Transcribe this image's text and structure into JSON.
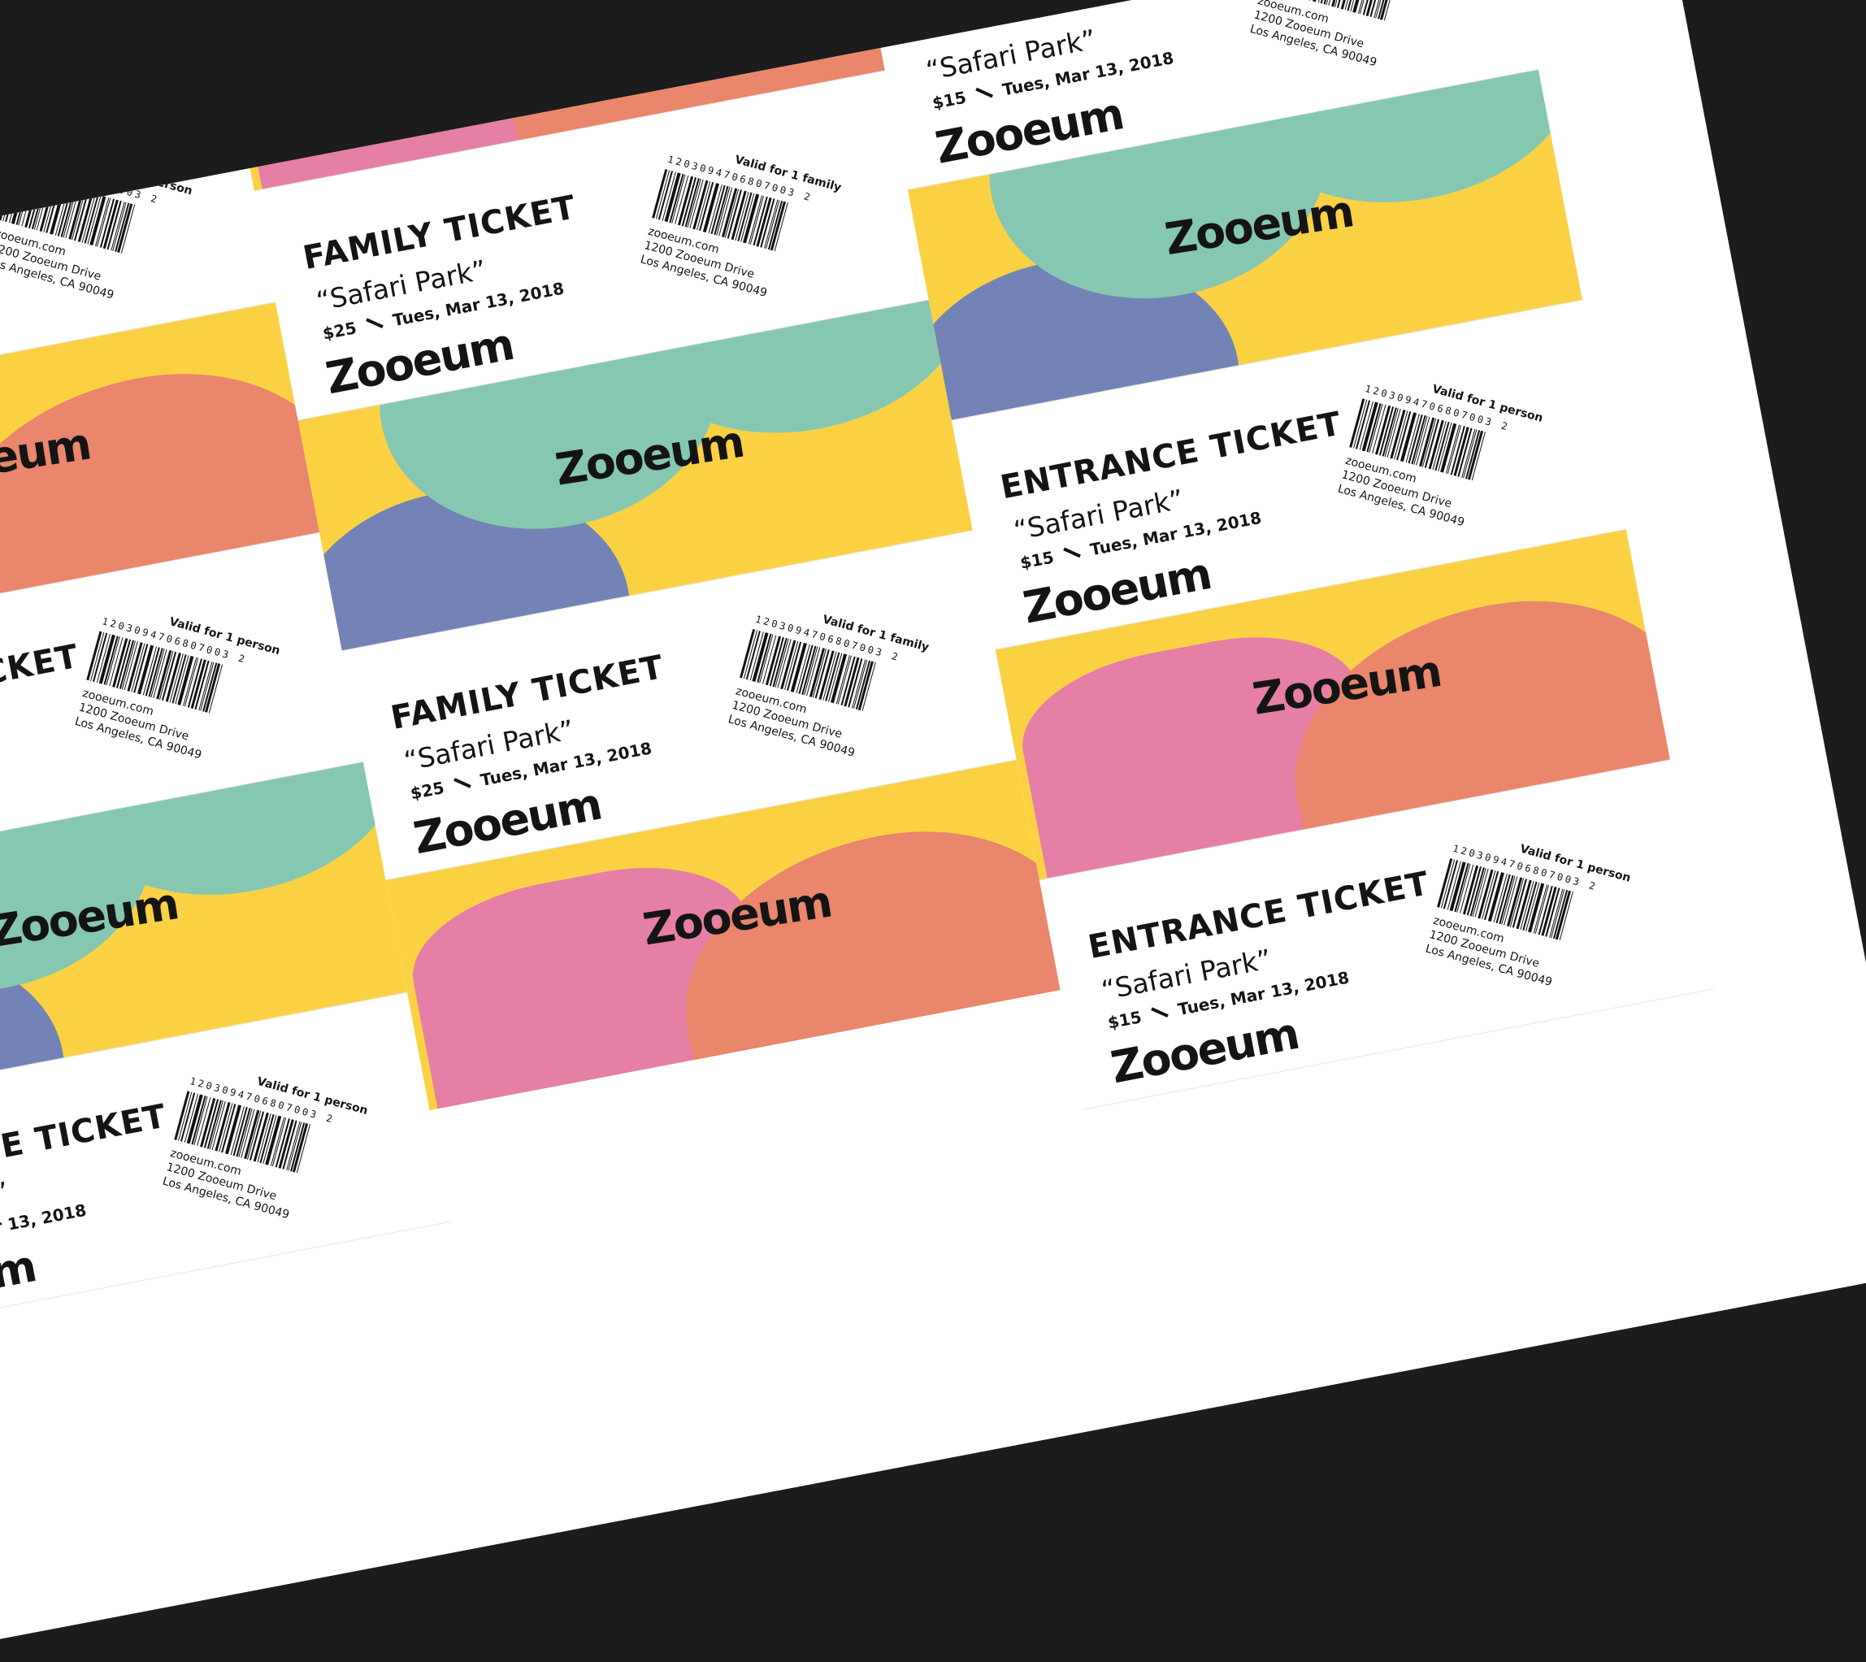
{
  "image_description_free": true,
  "colors": {
    "background": "#1c1c1c",
    "paper": "#ffffff",
    "yellow": "#fbd144",
    "pink": "#e57fa5",
    "coral": "#e9866b",
    "teal": "#86c7b2",
    "periwinkle": "#7383b5",
    "ink": "#141414"
  },
  "brand": "Zooeum",
  "tickets": {
    "entrance": {
      "title": "ENTRANCE TICKET",
      "event": "“Safari Park”",
      "price": "$15",
      "date": "Tues, Mar 13, 2018",
      "valid": "Valid for 1 person",
      "code": "1203094706807003 2",
      "site": "zooeum.com",
      "street": "1200 Zooeum Drive",
      "city": "Los Angeles, CA 90049"
    },
    "family": {
      "title": "FAMILY TICKET",
      "event": "“Safari Park”",
      "price": "$25",
      "date": "Tues, Mar 13, 2018",
      "valid": "Valid for 1 family",
      "code": "1203094706807003 2",
      "site": "zooeum.com",
      "street": "1200 Zooeum Drive",
      "city": "Los Angeles, CA 90049"
    }
  }
}
